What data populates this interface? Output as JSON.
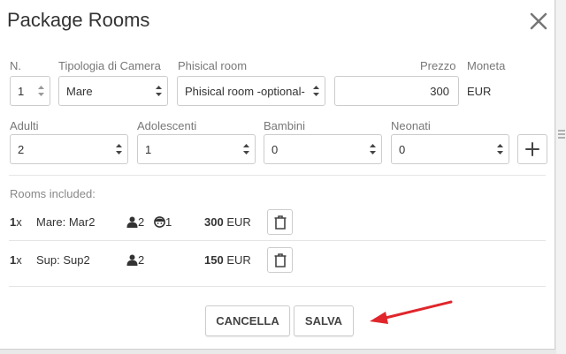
{
  "dialog": {
    "title": "Package Rooms",
    "close_icon": "close-icon"
  },
  "row1": {
    "n": {
      "label": "N.",
      "value": "1"
    },
    "tipologia": {
      "label": "Tipologia di Camera",
      "value": "Mare"
    },
    "phisical": {
      "label": "Phisical room",
      "value": "Phisical room -optional-"
    },
    "prezzo": {
      "label": "Prezzo",
      "value": "300"
    },
    "moneta": {
      "label": "Moneta",
      "value": "EUR"
    }
  },
  "row2": {
    "adulti": {
      "label": "Adulti",
      "value": "2"
    },
    "adolescenti": {
      "label": "Adolescenti",
      "value": "1"
    },
    "bambini": {
      "label": "Bambini",
      "value": "0"
    },
    "neonati": {
      "label": "Neonati",
      "value": "0"
    },
    "add_icon": "plus-icon"
  },
  "rooms": {
    "heading": "Rooms included:",
    "items": [
      {
        "qty": "1",
        "mult": "x",
        "name": "Mare: Mar2",
        "adults": "2",
        "teens": "1",
        "price": "300",
        "currency": "EUR"
      },
      {
        "qty": "1",
        "mult": "x",
        "name": "Sup: Sup2",
        "adults": "2",
        "price": "150",
        "currency": "EUR"
      }
    ]
  },
  "footer": {
    "cancel_label": "CANCELLA",
    "save_label": "SALVA"
  },
  "colors": {
    "arrow": "#e0262b",
    "border": "#cccccc",
    "label": "#777777"
  }
}
